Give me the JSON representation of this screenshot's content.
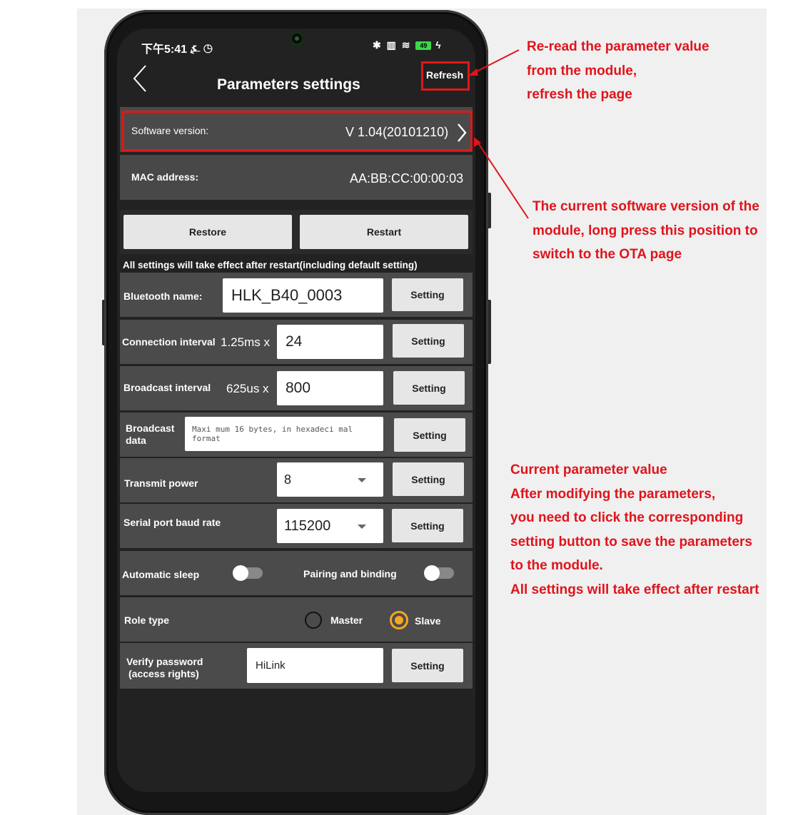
{
  "status_bar": {
    "time": "下午5:41 ⍼ ◷",
    "icons": "✱ ▥ ≋ 49 ϟ",
    "battery": "49"
  },
  "header": {
    "title": "Parameters settings",
    "refresh_label": "Refresh",
    "back_glyph": "<"
  },
  "info": {
    "software_label": "Software version:",
    "software_value": "V 1.04(20101210)",
    "mac_label": "MAC address:",
    "mac_value": "AA:BB:CC:00:00:03"
  },
  "actions": {
    "restore_label": "Restore",
    "restart_label": "Restart"
  },
  "notice": "All settings will take effect after restart(including default setting)",
  "params": {
    "bluetooth_name": {
      "label": "Bluetooth name:",
      "value": "HLK_B40_0003",
      "button": "Setting"
    },
    "connection_interval": {
      "label": "Connection interval",
      "unit": "1.25ms x",
      "value": "24",
      "button": "Setting"
    },
    "broadcast_interval": {
      "label": "Broadcast interval",
      "unit": "625us x",
      "value": "800",
      "button": "Setting"
    },
    "broadcast_data": {
      "label_line1": "Broadcast",
      "label_line2": "data",
      "placeholder": "Maxi mum 16 bytes, in hexadeci mal format",
      "button": "Setting"
    },
    "transmit_power": {
      "label": "Transmit power",
      "value": "8",
      "button": "Setting"
    },
    "baud_rate": {
      "label": "Serial port baud rate",
      "value": "115200",
      "button": "Setting"
    },
    "automatic_sleep": {
      "label": "Automatic sleep",
      "on": false
    },
    "pairing_binding": {
      "label": "Pairing and binding",
      "on": false
    },
    "role_type": {
      "label": "Role type",
      "options": [
        "Master",
        "Slave"
      ],
      "selected": "Slave"
    },
    "verify_password": {
      "label_line1": "Verify password",
      "label_line2": "(access rights)",
      "value": "HiLink",
      "button": "Setting"
    }
  },
  "annotations": {
    "refresh_note": [
      "Re-read the parameter value",
      "from the module,",
      "refresh the page"
    ],
    "version_note": [
      "The current software version of the",
      "module, long press this position to",
      "switch to the OTA page"
    ],
    "params_note": [
      "Current parameter value",
      "After modifying the parameters,",
      "you need to click the corresponding",
      "setting button to save the parameters",
      "to the module.",
      "All settings will take effect after restart"
    ]
  },
  "colors": {
    "accent": "#f5a623",
    "annotation": "#e0141c",
    "row": "#4b4b4b",
    "screen": "#222222"
  }
}
